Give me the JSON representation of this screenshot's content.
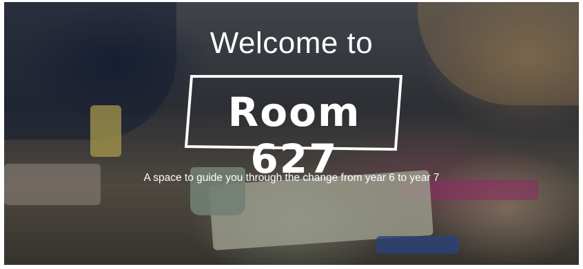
{
  "hero": {
    "heading": "Welcome to",
    "logo_text": "Room 627",
    "tagline": "A space to guide you through the change from year 6 to year 7"
  },
  "colors": {
    "text": "#ffffff",
    "overlay": "rgba(0,0,0,0.28)"
  }
}
